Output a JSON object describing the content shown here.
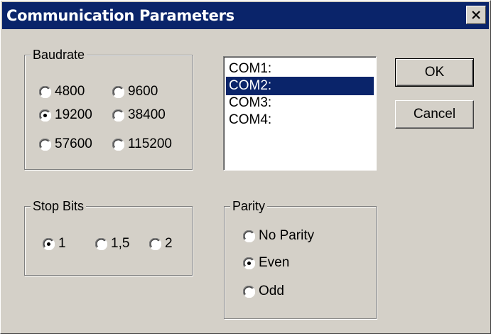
{
  "window": {
    "title": "Communication Parameters",
    "close_icon": "close-icon"
  },
  "baudrate": {
    "legend": "Baudrate",
    "options": [
      {
        "label": "4800",
        "checked": false
      },
      {
        "label": "9600",
        "checked": false
      },
      {
        "label": "19200",
        "checked": true
      },
      {
        "label": "38400",
        "checked": false
      },
      {
        "label": "57600",
        "checked": false
      },
      {
        "label": "115200",
        "checked": false
      }
    ]
  },
  "ports": {
    "items": [
      "COM1:",
      "COM2:",
      "COM3:",
      "COM4:"
    ],
    "selected": "COM2:"
  },
  "stopbits": {
    "legend": "Stop Bits",
    "options": [
      {
        "label": "1",
        "checked": true
      },
      {
        "label": "1,5",
        "checked": false
      },
      {
        "label": "2",
        "checked": false
      }
    ]
  },
  "parity": {
    "legend": "Parity",
    "options": [
      {
        "label": "No Parity",
        "checked": false
      },
      {
        "label": "Even",
        "checked": true
      },
      {
        "label": "Odd",
        "checked": false
      }
    ]
  },
  "buttons": {
    "ok": "OK",
    "cancel": "Cancel"
  },
  "colors": {
    "face": "#d4d0c8",
    "title_bar": "#0a246a",
    "selection": "#0a246a"
  }
}
